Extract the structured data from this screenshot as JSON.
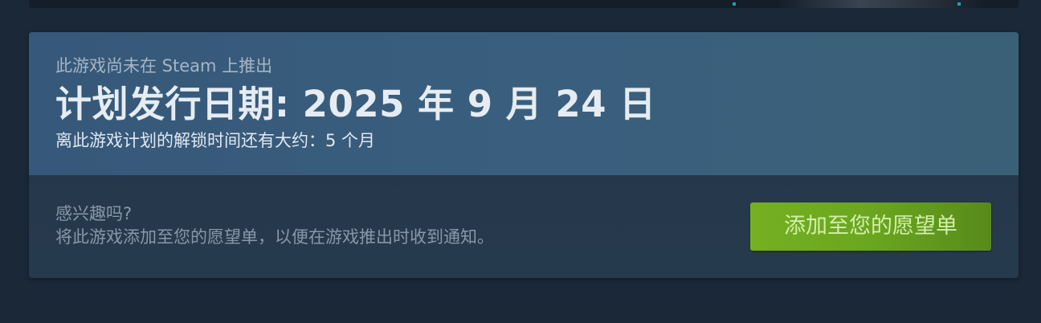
{
  "release": {
    "not_released_notice": "此游戏尚未在 Steam 上推出",
    "planned_date": "计划发行日期: 2025 年 9 月 24 日",
    "unlock_countdown": "离此游戏计划的解锁时间还有大约：5 个月"
  },
  "wishlist": {
    "question": "感兴趣吗?",
    "description": "将此游戏添加至您的愿望单，以便在游戏推出时收到通知。",
    "button_label": "添加至您的愿望单"
  },
  "colors": {
    "page_background": "#1b2838",
    "header_background": "#3a5f7e",
    "wishlist_background": "#263a4e",
    "button_green": "#6aa61f",
    "button_text": "#d2efa9"
  }
}
